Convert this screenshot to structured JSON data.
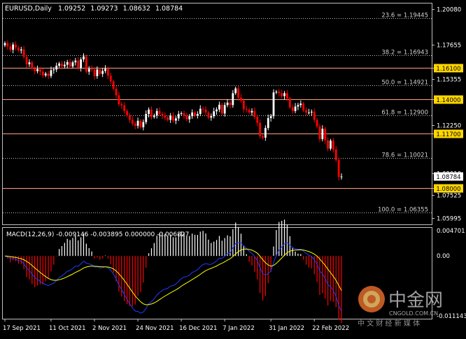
{
  "window": {
    "title": "EURUSD,Daily",
    "ohlc": [
      "1.09252",
      "1.09273",
      "1.08632",
      "1.08784"
    ]
  },
  "colors": {
    "background": "#000000",
    "frame": "#c0c0c0",
    "bull": "#ffffff",
    "bear": "#ff0000",
    "fib_line": "#c0c0c0",
    "sr_line": "#ffa07a",
    "sr_label_bg": "#ffd700",
    "sr_label_text": "#000000",
    "macd_signal": "#ffff00",
    "macd_main": "#1e3cff",
    "price_tag_bg": "#ffffff"
  },
  "price_axis": {
    "labels": [
      "1.20080",
      "1.17655",
      "1.15355",
      "1.12250",
      "1.09010",
      "1.07525",
      "1.05995"
    ],
    "current_price": "1.08784"
  },
  "fib_levels": [
    {
      "label": "23.6 = 1.19445",
      "price": 1.19445
    },
    {
      "label": "38.2 = 1.16943",
      "price": 1.16943
    },
    {
      "label": "50.0 = 1.14921",
      "price": 1.14921
    },
    {
      "label": "61.8 = 1.12900",
      "price": 1.129
    },
    {
      "label": "78.6 = 1.10021",
      "price": 1.10021
    },
    {
      "label": "100.0 = 1.06355",
      "price": 1.06355
    }
  ],
  "sr_levels": [
    {
      "label": "1.16100",
      "price": 1.161
    },
    {
      "label": "1.14000",
      "price": 1.14
    },
    {
      "label": "1.11700",
      "price": 1.117
    },
    {
      "label": "1.08000",
      "price": 1.08
    }
  ],
  "macd": {
    "label": "MACD(12,26,9) -0.009146 -0.003895 0.000000 -0.006827",
    "axis_labels": [
      "0.004701",
      "0.00",
      "-0.011143"
    ]
  },
  "time_axis": {
    "labels": [
      "17 Sep 2021",
      "11 Oct 2021",
      "2 Nov 2021",
      "24 Nov 2021",
      "16 Dec 2021",
      "7 Jan 2022",
      "31 Jan 2022",
      "22 Feb 2022"
    ]
  },
  "watermark": {
    "brand": "中金网",
    "domain": "CNGOLD.COM.CN",
    "tagline": "中 文 财 经 新 媒 体"
  },
  "chart_data": {
    "type": "candlestick",
    "symbol": "EURUSD",
    "timeframe": "Daily",
    "price_range": [
      1.0555,
      1.2045
    ],
    "closes": [
      1.1778,
      1.1755,
      1.1733,
      1.1768,
      1.1748,
      1.1728,
      1.1735,
      1.1685,
      1.1635,
      1.1648,
      1.1605,
      1.1588,
      1.1602,
      1.1585,
      1.156,
      1.1572,
      1.1556,
      1.1595,
      1.16,
      1.1625,
      1.164,
      1.1621,
      1.1632,
      1.165,
      1.162,
      1.1648,
      1.166,
      1.161,
      1.1668,
      1.1688,
      1.1585,
      1.1604,
      1.16,
      1.1555,
      1.16,
      1.157,
      1.159,
      1.1605,
      1.1558,
      1.152,
      1.147,
      1.1425,
      1.1366,
      1.1358,
      1.132,
      1.129,
      1.126,
      1.1235,
      1.122,
      1.1254,
      1.121,
      1.1245,
      1.13,
      1.1329,
      1.128,
      1.129,
      1.132,
      1.13,
      1.129,
      1.1275,
      1.126,
      1.1288,
      1.1255,
      1.127,
      1.13,
      1.1305,
      1.1285,
      1.1264,
      1.1285,
      1.131,
      1.129,
      1.13,
      1.1335,
      1.133,
      1.131,
      1.1275,
      1.1285,
      1.1318,
      1.133,
      1.1362,
      1.1303,
      1.136,
      1.1376,
      1.136,
      1.144,
      1.1472,
      1.141,
      1.139,
      1.1332,
      1.1328,
      1.131,
      1.132,
      1.128,
      1.124,
      1.115,
      1.114,
      1.1205,
      1.1272,
      1.1285,
      1.1445,
      1.145,
      1.144,
      1.142,
      1.144,
      1.1405,
      1.1345,
      1.132,
      1.135,
      1.136,
      1.137,
      1.1325,
      1.131,
      1.131,
      1.1315,
      1.126,
      1.1215,
      1.113,
      1.12,
      1.1122,
      1.1066,
      1.112,
      1.106,
      1.099,
      1.0875,
      1.0878
    ]
  }
}
